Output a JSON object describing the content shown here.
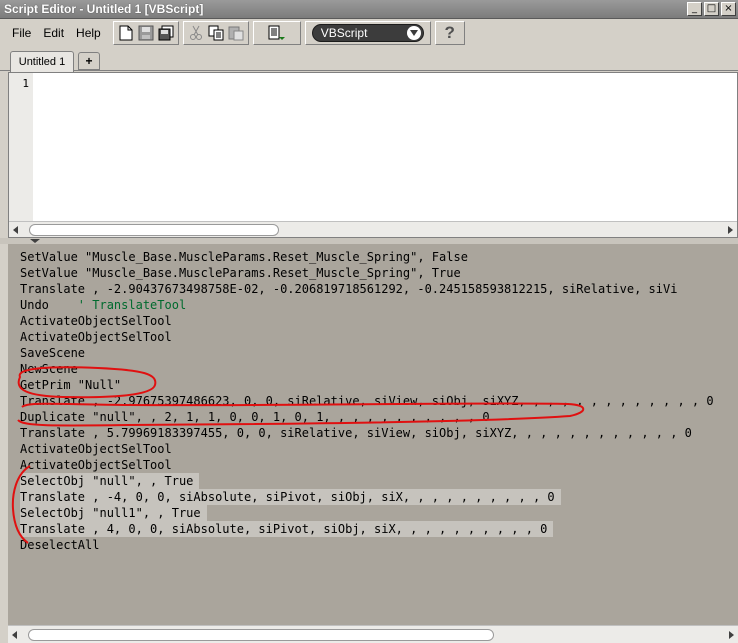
{
  "window": {
    "title": "Script Editor - Untitled 1  [VBScript]",
    "controls": {
      "minimize": "_",
      "maximize": "□",
      "close": "×"
    }
  },
  "menu": {
    "file": "File",
    "edit": "Edit",
    "help": "Help"
  },
  "toolbar": {
    "language": "VBScript",
    "help_label": "?",
    "icons": [
      "new-file-icon",
      "save-icon",
      "save-all-icon",
      "cut-icon",
      "copy-icon",
      "paste-icon",
      "run-script-icon"
    ]
  },
  "tabs": {
    "active": "Untitled 1",
    "add_label": "+"
  },
  "editor": {
    "line_numbers": [
      "1"
    ]
  },
  "log": {
    "lines": [
      {
        "text": "SetValue \"Muscle_Base.MuscleParams.Reset_Muscle_Spring\", False"
      },
      {
        "text": "SetValue \"Muscle_Base.MuscleParams.Reset_Muscle_Spring\", True"
      },
      {
        "text": "Translate , -2.90437673498758E-02, -0.206819718561292, -0.245158593812215, siRelative, siVi"
      },
      {
        "text": "Undo    ",
        "comment": "' TranslateTool"
      },
      {
        "text": "ActivateObjectSelTool"
      },
      {
        "text": "ActivateObjectSelTool"
      },
      {
        "text": "SaveScene"
      },
      {
        "text": "NewScene"
      },
      {
        "text": "GetPrim \"Null\""
      },
      {
        "text": "Translate , -2.97675397486623, 0, 0, siRelative, siView, siObj, siXYZ, , , , , , , , , , , , , 0"
      },
      {
        "text": "Duplicate \"null\", , 2, 1, 1, 0, 0, 1, 0, 1, , , , , , , , , , , 0"
      },
      {
        "text": "Translate , 5.79969183397455, 0, 0, siRelative, siView, siObj, siXYZ, , , , , , , , , , , , 0"
      },
      {
        "text": "ActivateObjectSelTool"
      },
      {
        "text": "ActivateObjectSelTool"
      },
      {
        "text": "SelectObj \"null\", , True",
        "highlight": true
      },
      {
        "text": "Translate , -4, 0, 0, siAbsolute, siPivot, siObj, siX, , , , , , , , , , 0",
        "highlight": true
      },
      {
        "text": "SelectObj \"null1\", , True",
        "highlight": true
      },
      {
        "text": "Translate , 4, 0, 0, siAbsolute, siPivot, siObj, siX, , , , , , , , , , 0",
        "highlight": true
      },
      {
        "text": "DeselectAll"
      }
    ]
  },
  "colors": {
    "log_background": "#aaa59c",
    "annotation": "#e01010",
    "comment": "#006a2e"
  }
}
